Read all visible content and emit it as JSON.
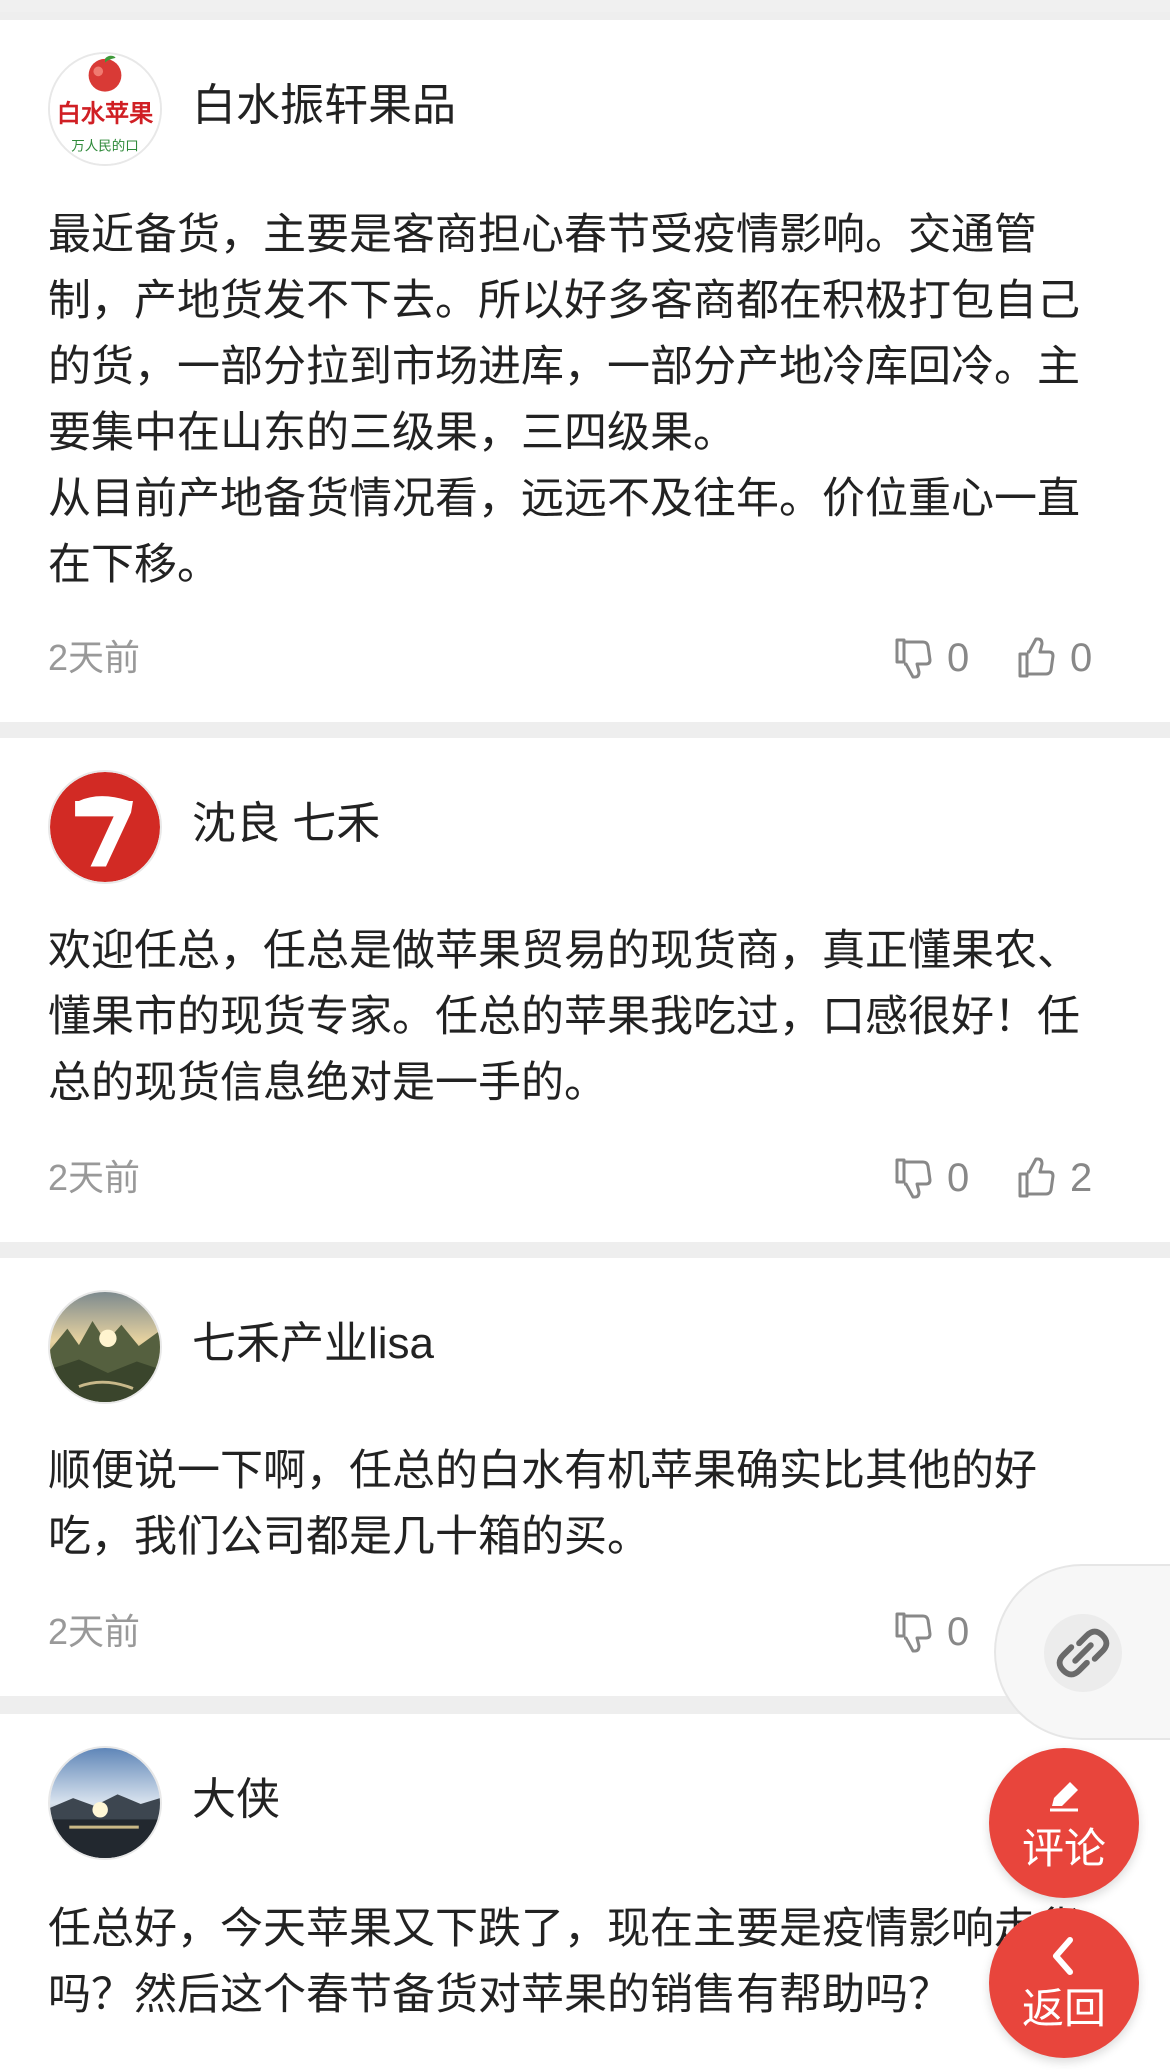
{
  "comments": [
    {
      "user": "白水振轩果品",
      "avatar": "baishui-apple-logo",
      "lines": [
        "最近备货，主要是客商担心春节受疫情影响。交通管",
        "制，产地货发不下去。所以好多客商都在积极打包自己",
        "的货，一部分拉到市场进库，一部分产地冷库回冷。主",
        "要集中在山东的三级果，三四级果。",
        "从目前产地备货情况看，远远不及往年。价位重心一直",
        "在下移。"
      ],
      "time": "2天前",
      "dislikes": "0",
      "likes": "0"
    },
    {
      "user": "沈良 七禾",
      "avatar": "qihe-logo",
      "lines": [
        "欢迎任总，任总是做苹果贸易的现货商，真正懂果农、",
        "懂果市的现货专家。任总的苹果我吃过，口感很好！任",
        "总的现货信息绝对是一手的。"
      ],
      "time": "2天前",
      "dislikes": "0",
      "likes": "2"
    },
    {
      "user": "七禾产业lisa",
      "avatar": "landscape-photo",
      "lines": [
        "顺便说一下啊，任总的白水有机苹果确实比其他的好",
        "吃，我们公司都是几十箱的买。"
      ],
      "time": "2天前",
      "dislikes": "0"
    },
    {
      "user": "大侠",
      "avatar": "sunset-photo",
      "lines": [
        "任总好，今天苹果又下跌了，现在主要是疫情影响走货",
        "吗？然后这个春节备货对苹果的销售有帮助吗？"
      ]
    }
  ],
  "avatar_text": {
    "baishui_main": "白水苹果",
    "baishui_sub": "万人民的口"
  },
  "actions": {
    "share_icon": "link-icon",
    "comment_label": "评论",
    "comment_icon": "pencil-icon",
    "back_label": "返回",
    "back_icon": "chevron-left-icon"
  },
  "colors": {
    "accent": "#e8453c",
    "text": "#222222",
    "muted": "#999999",
    "background": "#eeeeee"
  }
}
